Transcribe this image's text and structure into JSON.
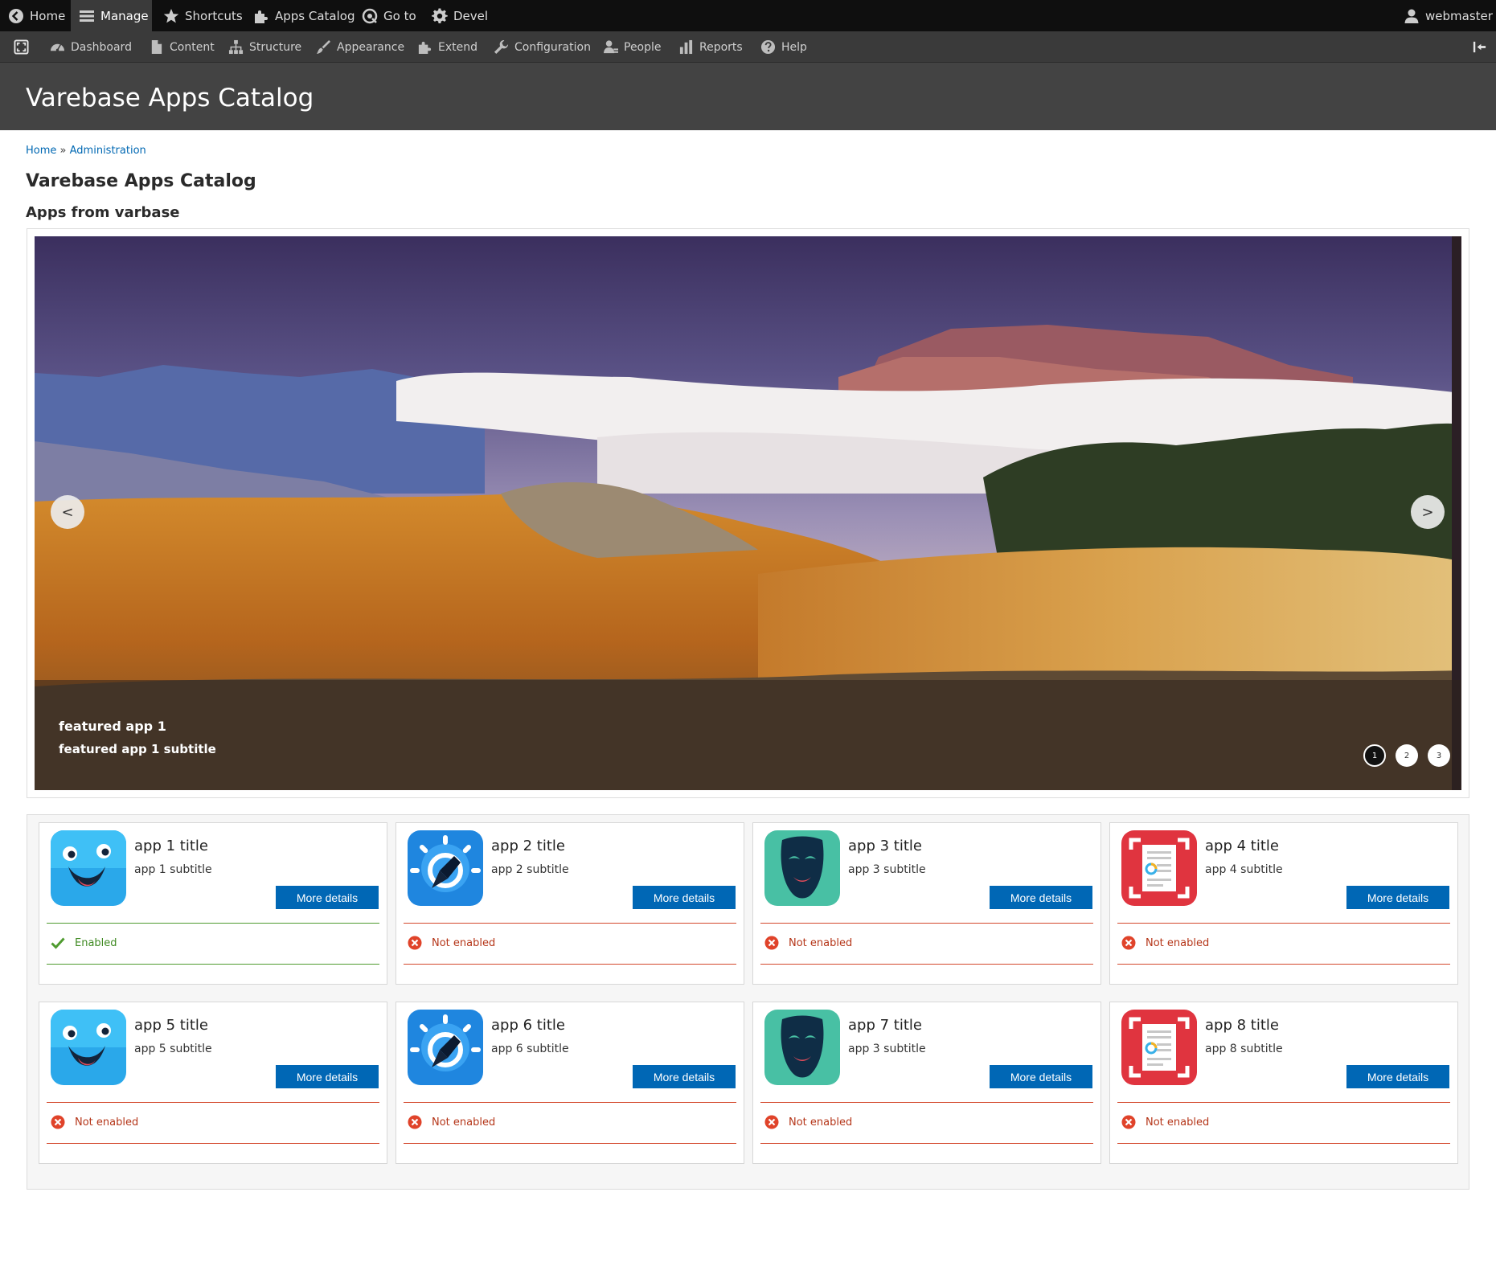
{
  "toolbar_top": {
    "items": [
      {
        "label": "Home",
        "icon": "back-arrow-icon"
      },
      {
        "label": "Manage",
        "icon": "hamburger-icon"
      },
      {
        "label": "Shortcuts",
        "icon": "star-icon"
      },
      {
        "label": "Apps Catalog",
        "icon": "puzzle-icon"
      },
      {
        "label": "Go to",
        "icon": "goto-icon"
      },
      {
        "label": "Devel",
        "icon": "gear-icon"
      }
    ],
    "user": {
      "label": "webmaster",
      "icon": "user-icon"
    }
  },
  "toolbar_admin": {
    "items": [
      {
        "label": "Dashboard",
        "icon": "dashboard-icon"
      },
      {
        "label": "Content",
        "icon": "document-icon"
      },
      {
        "label": "Structure",
        "icon": "structure-icon"
      },
      {
        "label": "Appearance",
        "icon": "brush-icon"
      },
      {
        "label": "Extend",
        "icon": "puzzle-icon"
      },
      {
        "label": "Configuration",
        "icon": "wrench-icon"
      },
      {
        "label": "People",
        "icon": "people-icon"
      },
      {
        "label": "Reports",
        "icon": "bar-chart-icon"
      },
      {
        "label": "Help",
        "icon": "help-icon"
      }
    ]
  },
  "page": {
    "header_title": "Varebase Apps Catalog",
    "breadcrumb": {
      "home": "Home",
      "separator": "»",
      "admin": "Administration"
    },
    "section_title": "Varebase Apps Catalog",
    "subsection_title": "Apps from varbase"
  },
  "slider": {
    "prev": "<",
    "next": ">",
    "caption_title": "featured app 1",
    "caption_subtitle": "featured app 1 subtitle",
    "pager": [
      "1",
      "2",
      "3"
    ],
    "active_slide": 1,
    "image": "mountain-landscape-image"
  },
  "apps": [
    {
      "title": "app 1 title",
      "subtitle": "app 1 subtitle",
      "button": "More details",
      "status": "Enabled",
      "enabled": true,
      "icon": "smiley-app-icon"
    },
    {
      "title": "app 2 title",
      "subtitle": "app 2 subtitle",
      "button": "More details",
      "status": "Not enabled",
      "enabled": false,
      "icon": "pen-app-icon"
    },
    {
      "title": "app 3 title",
      "subtitle": "app 3 subtitle",
      "button": "More details",
      "status": "Not enabled",
      "enabled": false,
      "icon": "mask-app-icon"
    },
    {
      "title": "app 4 title",
      "subtitle": "app 4 subtitle",
      "button": "More details",
      "status": "Not enabled",
      "enabled": false,
      "icon": "scanner-app-icon"
    },
    {
      "title": "app 5 title",
      "subtitle": "app 5 subtitle",
      "button": "More details",
      "status": "Not enabled",
      "enabled": false,
      "icon": "smiley-app-icon"
    },
    {
      "title": "app 6 title",
      "subtitle": "app 6 subtitle",
      "button": "More details",
      "status": "Not enabled",
      "enabled": false,
      "icon": "pen-app-icon"
    },
    {
      "title": "app 7 title",
      "subtitle": "app 3 subtitle",
      "button": "More details",
      "status": "Not enabled",
      "enabled": false,
      "icon": "mask-app-icon"
    },
    {
      "title": "app 8 title",
      "subtitle": "app 8 subtitle",
      "button": "More details",
      "status": "Not enabled",
      "enabled": false,
      "icon": "scanner-app-icon"
    }
  ],
  "colors": {
    "toolbar_dark": "#0f0f0f",
    "toolbar_admin": "#3a3a3a",
    "header_bg": "#434343",
    "link": "#0068b3",
    "button": "#0067b5",
    "enabled": "#3f8a22",
    "not_enabled": "#b53619"
  }
}
